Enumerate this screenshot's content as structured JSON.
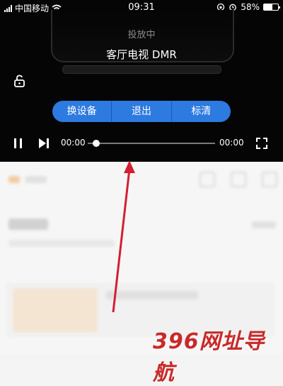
{
  "status_bar": {
    "carrier": "中国移动",
    "time": "09:31",
    "battery": "58%",
    "battery_level": 0.58
  },
  "player": {
    "cast_status": "投放中",
    "device_name": "客厅电视 DMR",
    "buttons": [
      "换设备",
      "退出",
      "标清"
    ],
    "time_current": "00:00",
    "time_total": "00:00",
    "progress": 0.0
  },
  "overlay": {
    "watermark": "396网址导航"
  },
  "colors": {
    "accent_button": "#2d7ae0",
    "arrow": "#d21f32",
    "watermark": "#c82a2a"
  }
}
